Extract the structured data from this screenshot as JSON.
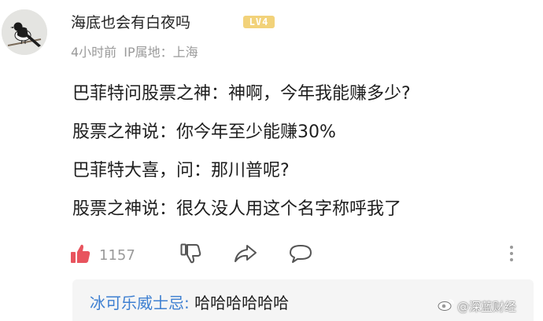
{
  "post": {
    "username": "海底也会有白夜吗",
    "level_badge": "LV4",
    "timestamp": "4小时前",
    "location": "IP属地：上海",
    "lines": [
      "巴菲特问股票之神：神啊，今年我能赚多少?",
      "股票之神说：你今年至少能赚30%",
      "巴菲特大喜，问：那川普呢?",
      "股票之神说：很久没人用这个名字称呼我了"
    ],
    "like_count": "1157"
  },
  "reply": {
    "author": "冰可乐威士忌",
    "separator": ":",
    "text": "哈哈哈哈哈哈"
  },
  "watermark": {
    "text": "@深蓝财经",
    "icon": "weibo-icon"
  },
  "colors": {
    "link": "#3d7fd1",
    "like": "#e8545e",
    "meta": "#9a9a9a",
    "badge": "#f2d27a",
    "reply_background": "#f5f5f5"
  },
  "icons": {
    "like": "thumbs-up-icon",
    "dislike": "thumbs-down-icon",
    "share": "share-icon",
    "comment": "comment-icon",
    "more": "more-vertical-icon"
  }
}
